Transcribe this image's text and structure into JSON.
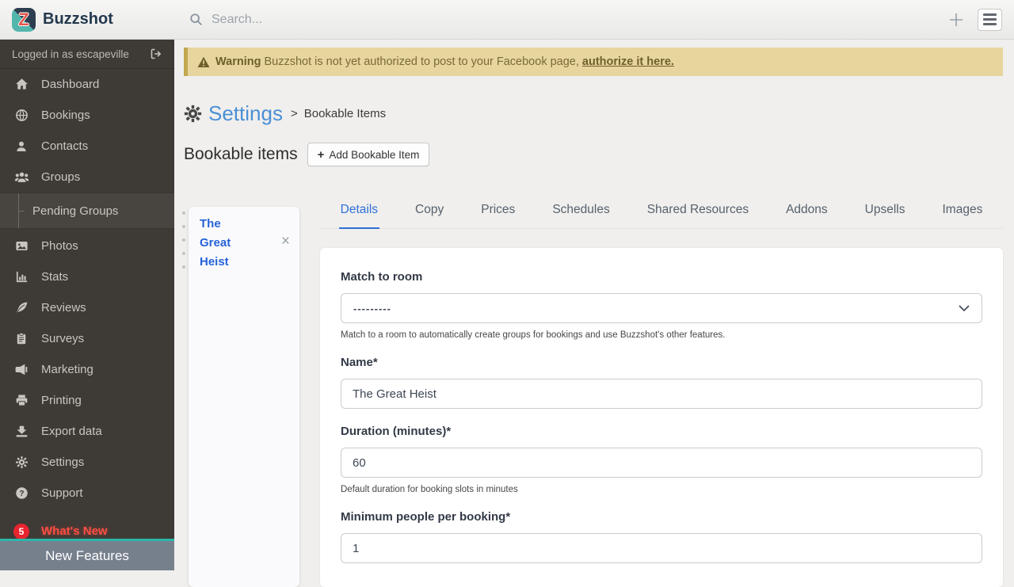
{
  "brand": {
    "name": "Buzzshot",
    "logo_letter": "Z"
  },
  "topbar": {
    "search_placeholder": "Search..."
  },
  "sidebar": {
    "logged_in": "Logged in as escapeville",
    "items": [
      {
        "label": "Dashboard"
      },
      {
        "label": "Bookings"
      },
      {
        "label": "Contacts"
      },
      {
        "label": "Groups"
      },
      {
        "label": "Pending Groups"
      },
      {
        "label": "Photos"
      },
      {
        "label": "Stats"
      },
      {
        "label": "Reviews"
      },
      {
        "label": "Surveys"
      },
      {
        "label": "Marketing"
      },
      {
        "label": "Printing"
      },
      {
        "label": "Export data"
      },
      {
        "label": "Settings"
      },
      {
        "label": "Support"
      },
      {
        "label": "What's New",
        "badge": "5"
      }
    ],
    "new_features_label": "New Features"
  },
  "warning": {
    "prefix": "Warning",
    "message": "Buzzshot is not yet authorized to post to your Facebook page,",
    "link": "authorize it here."
  },
  "breadcrumb": {
    "section": "Settings",
    "separator": ">",
    "page": "Bookable Items"
  },
  "page": {
    "title": "Bookable items",
    "add_button_plus": "+",
    "add_button_label": "Add Bookable Item"
  },
  "item_list": {
    "selected_item": "The Great Heist",
    "close_glyph": "×"
  },
  "tabs": [
    "Details",
    "Copy",
    "Prices",
    "Schedules",
    "Shared Resources",
    "Addons",
    "Upsells",
    "Images"
  ],
  "form": {
    "match_to_room": {
      "label": "Match to room",
      "value": "---------",
      "help": "Match to a room to automatically create groups for bookings and use Buzzshot's other features."
    },
    "name": {
      "label": "Name*",
      "value": "The Great Heist"
    },
    "duration": {
      "label": "Duration (minutes)*",
      "value": "60",
      "help": "Default duration for booking slots in minutes"
    },
    "min_people": {
      "label": "Minimum people per booking*",
      "value": "1"
    }
  },
  "colors": {
    "brand_navy": "#2d3e50",
    "brand_teal": "#53b6ad",
    "logo_letter_red": "#e4574d",
    "sidebar_bg": "#3e3a36",
    "link_blue": "#4a8fd6",
    "active_tab_blue": "#2e6fd8",
    "item_name_blue": "#2563d8",
    "warning_bg": "#e7d59e",
    "warning_border": "#c3a74f",
    "warning_text": "#7a6b33",
    "whats_new_red": "#ff4f43",
    "badge_red": "#e8252e",
    "new_features_teal": "#2ab7a9",
    "new_features_bg": "#76808d"
  }
}
